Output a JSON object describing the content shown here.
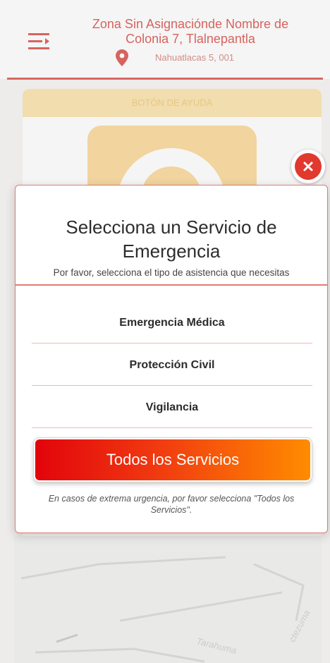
{
  "header": {
    "title": "Zona Sin Asignaciónde Nombre de Colonia 7, Tlalnepantla",
    "address": "Nahuatlacas 5, 001",
    "menu_icon": "menu-icon",
    "location_icon": "map-pin-icon"
  },
  "help_panel": {
    "label": "BOTÓN DE AYUDA"
  },
  "map": {
    "streets": [
      "Tarahuma",
      "ctezuma"
    ]
  },
  "modal": {
    "title": "Selecciona un Servicio de Emergencia",
    "subtitle": "Por favor, selecciona el tipo de asistencia que necesitas",
    "options": [
      {
        "label": "Emergencia Médica"
      },
      {
        "label": "Protección Civil"
      },
      {
        "label": "Vigilancia"
      }
    ],
    "all_services_label": "Todos los Servicios",
    "note": "En casos de extrema urgencia, por favor selecciona \"Todos los Servicios\".",
    "close_icon": "close-icon"
  },
  "colors": {
    "accent": "#e0645f",
    "close": "#e2392e",
    "gradient_start": "#e2040c",
    "gradient_end": "#ff8c00"
  }
}
